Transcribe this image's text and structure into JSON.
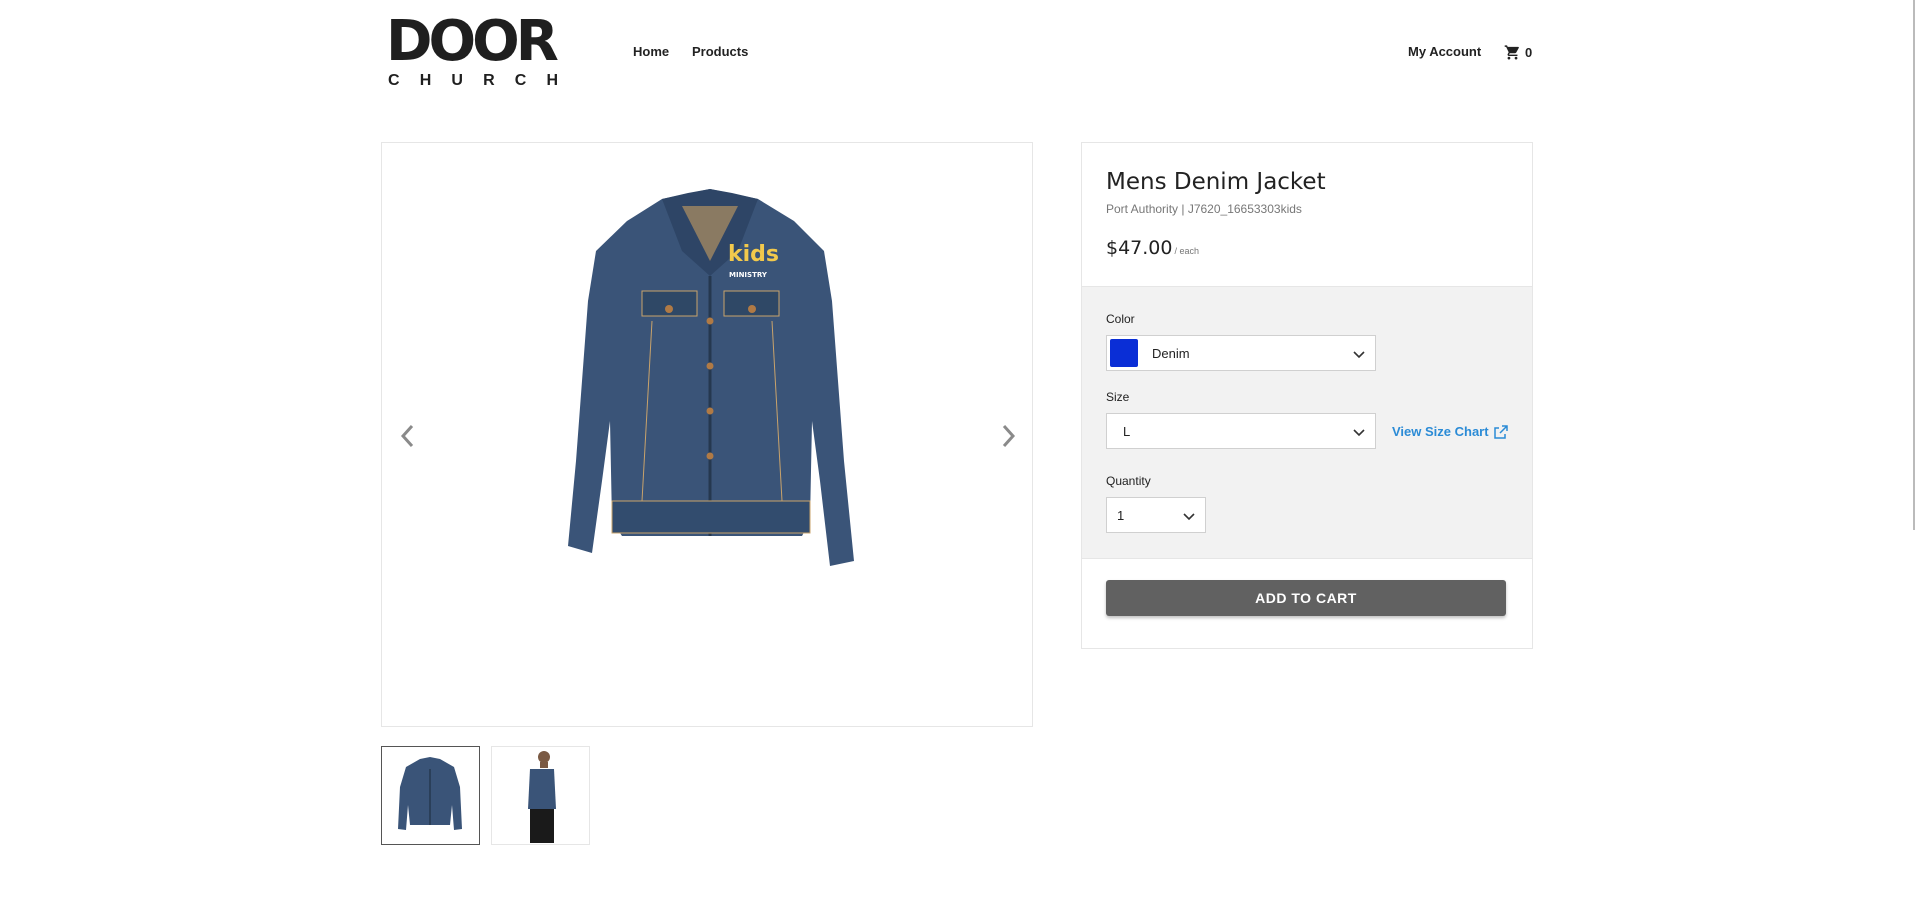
{
  "header": {
    "logo_main": "DOOR",
    "logo_sub": [
      "C",
      "H",
      "U",
      "R",
      "C",
      "H"
    ],
    "nav_home": "Home",
    "nav_products": "Products",
    "my_account": "My Account",
    "cart_count": "0"
  },
  "product": {
    "title": "Mens Denim Jacket",
    "subtitle": "Port Authority | J7620_16653303kids",
    "price": "$47.00",
    "price_unit": "/ each",
    "color_label": "Color",
    "color_value": "Denim",
    "color_swatch": "#0a2ed6",
    "size_label": "Size",
    "size_value": "L",
    "size_chart_link": "View Size Chart",
    "quantity_label": "Quantity",
    "quantity_value": "1",
    "add_to_cart": "ADD TO CART"
  },
  "gallery": {
    "prev_icon": "chevron-left-icon",
    "next_icon": "chevron-right-icon",
    "thumbnails": [
      "jacket-front",
      "model-side"
    ],
    "logo_text": "kids",
    "logo_sub": "MINISTRY"
  },
  "colors": {
    "accent_link": "#2b8bd6",
    "button": "#616161",
    "denim": "#3a5478"
  }
}
